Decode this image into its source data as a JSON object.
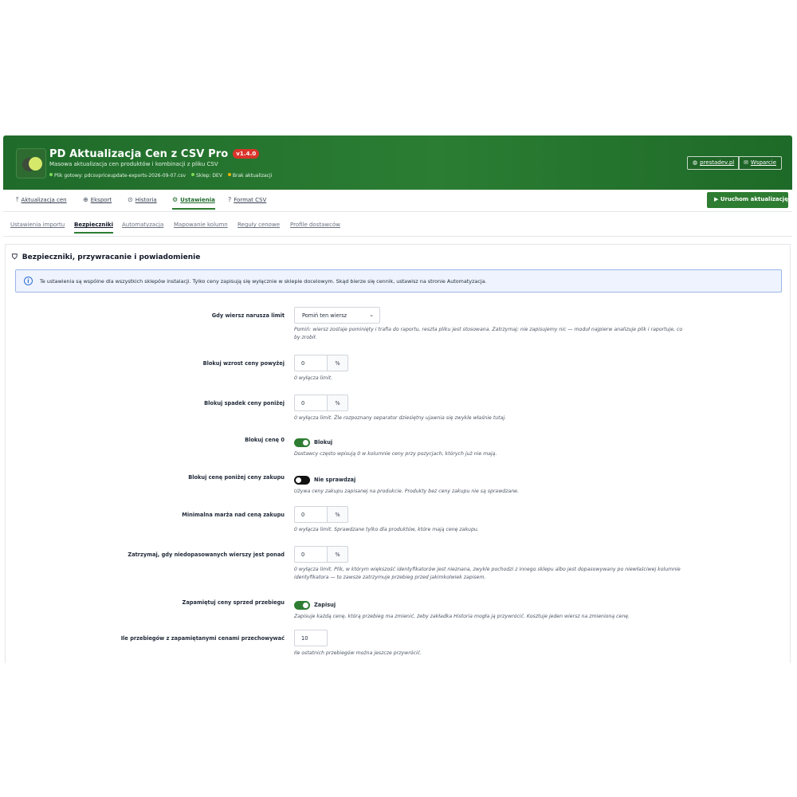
{
  "header": {
    "title": "PD Aktualizacja Cen z CSV Pro",
    "version": "v1.4.0",
    "subtitle": "Masowa aktualizacja cen produktów i kombinacji z pliku CSV",
    "status": {
      "file": "Plik gotowy: pdcsvpriceupdate-exports-2026-09-07.csv",
      "shop": "Sklep: DEV",
      "updates": "Brak aktualizacji"
    },
    "website_label": "prestadev.pl",
    "support_label": "Wsparcie"
  },
  "main_tabs": [
    {
      "label": "Aktualizacja cen",
      "icon": "upload-icon"
    },
    {
      "label": "Eksport",
      "icon": "download-icon"
    },
    {
      "label": "Historia",
      "icon": "history-icon"
    },
    {
      "label": "Ustawienia",
      "icon": "gears-icon"
    },
    {
      "label": "Format CSV",
      "icon": "help-icon"
    }
  ],
  "run_button": "Uruchom aktualizację",
  "sub_tabs": [
    "Ustawienia importu",
    "Bezpieczniki",
    "Automatyzacja",
    "Mapowanie kolumn",
    "Reguły cenowe",
    "Profile dostawców"
  ],
  "panel": {
    "title": "Bezpieczniki, przywracanie i powiadomienie",
    "info": "Te ustawienia są wspólne dla wszystkich sklepów instalacji. Tylko ceny zapisują się wyłącznie w sklepie docelowym. Skąd bierze się cennik, ustawisz na stronie Automatyzacja."
  },
  "fields": {
    "limit_action": {
      "label": "Gdy wiersz narusza limit",
      "value": "Pomiń ten wiersz",
      "hint1": "Pomiń: wiersz zostaje pominięty i trafia do raportu, reszta pliku jest stosowana. Zatrzymaj: nie zapisujemy nic — moduł najpierw analizuje plik i raportuje, co",
      "hint2": "by zrobił."
    },
    "block_increase": {
      "label": "Blokuj wzrost ceny powyżej",
      "value": "0",
      "unit": "%",
      "hint": "0 wyłącza limit."
    },
    "block_decrease": {
      "label": "Blokuj spadek ceny poniżej",
      "value": "0",
      "unit": "%",
      "hint": "0 wyłącza limit. Źle rozpoznany separator dziesiętny ujawnia się zwykle właśnie tutaj."
    },
    "block_zero": {
      "label": "Blokuj cenę 0",
      "state": "Blokuj",
      "hint": "Dostawcy często wpisują 0 w kolumnie ceny przy pozycjach, których już nie mają."
    },
    "block_below_cost": {
      "label": "Blokuj cenę poniżej ceny zakupu",
      "state": "Nie sprawdzaj",
      "hint": "Używa ceny zakupu zapisanej na produkcie. Produkty bez ceny zakupu nie są sprawdzane."
    },
    "min_margin": {
      "label": "Minimalna marża nad ceną zakupu",
      "value": "0",
      "unit": "%",
      "hint": "0 wyłącza limit. Sprawdzane tylko dla produktów, które mają cenę zakupu."
    },
    "unmatched_stop": {
      "label": "Zatrzymaj, gdy niedopasowanych wierszy jest ponad",
      "value": "0",
      "unit": "%",
      "hint1": "0 wyłącza limit. Plik, w którym większość identyfikatorów jest nieznana, zwykle pochodzi z innego sklepu albo jest dopasowywany po niewłaściwej kolumnie",
      "hint2": "identyfikatora — to zawsze zatrzymuje przebieg przed jakimkolwiek zapisem."
    },
    "remember_prices": {
      "label": "Zapamiętuj ceny sprzed przebiegu",
      "state": "Zapisuj",
      "hint": "Zapisuje każdą cenę, którą przebieg ma zmienić, żeby zakładka Historia mogła ją przywrócić. Kosztuje jeden wiersz na zmienioną cenę."
    },
    "runs_kept": {
      "label": "Ile przebiegów z zapamiętanymi cenami przechowywać",
      "value": "10",
      "hint": "Ile ostatnich przebiegów można jeszcze przywrócić."
    }
  },
  "colors": {
    "brand": "#2e7d32",
    "badge": "#d9342b",
    "status_green": "#7ed957",
    "status_orange": "#f4b400"
  }
}
